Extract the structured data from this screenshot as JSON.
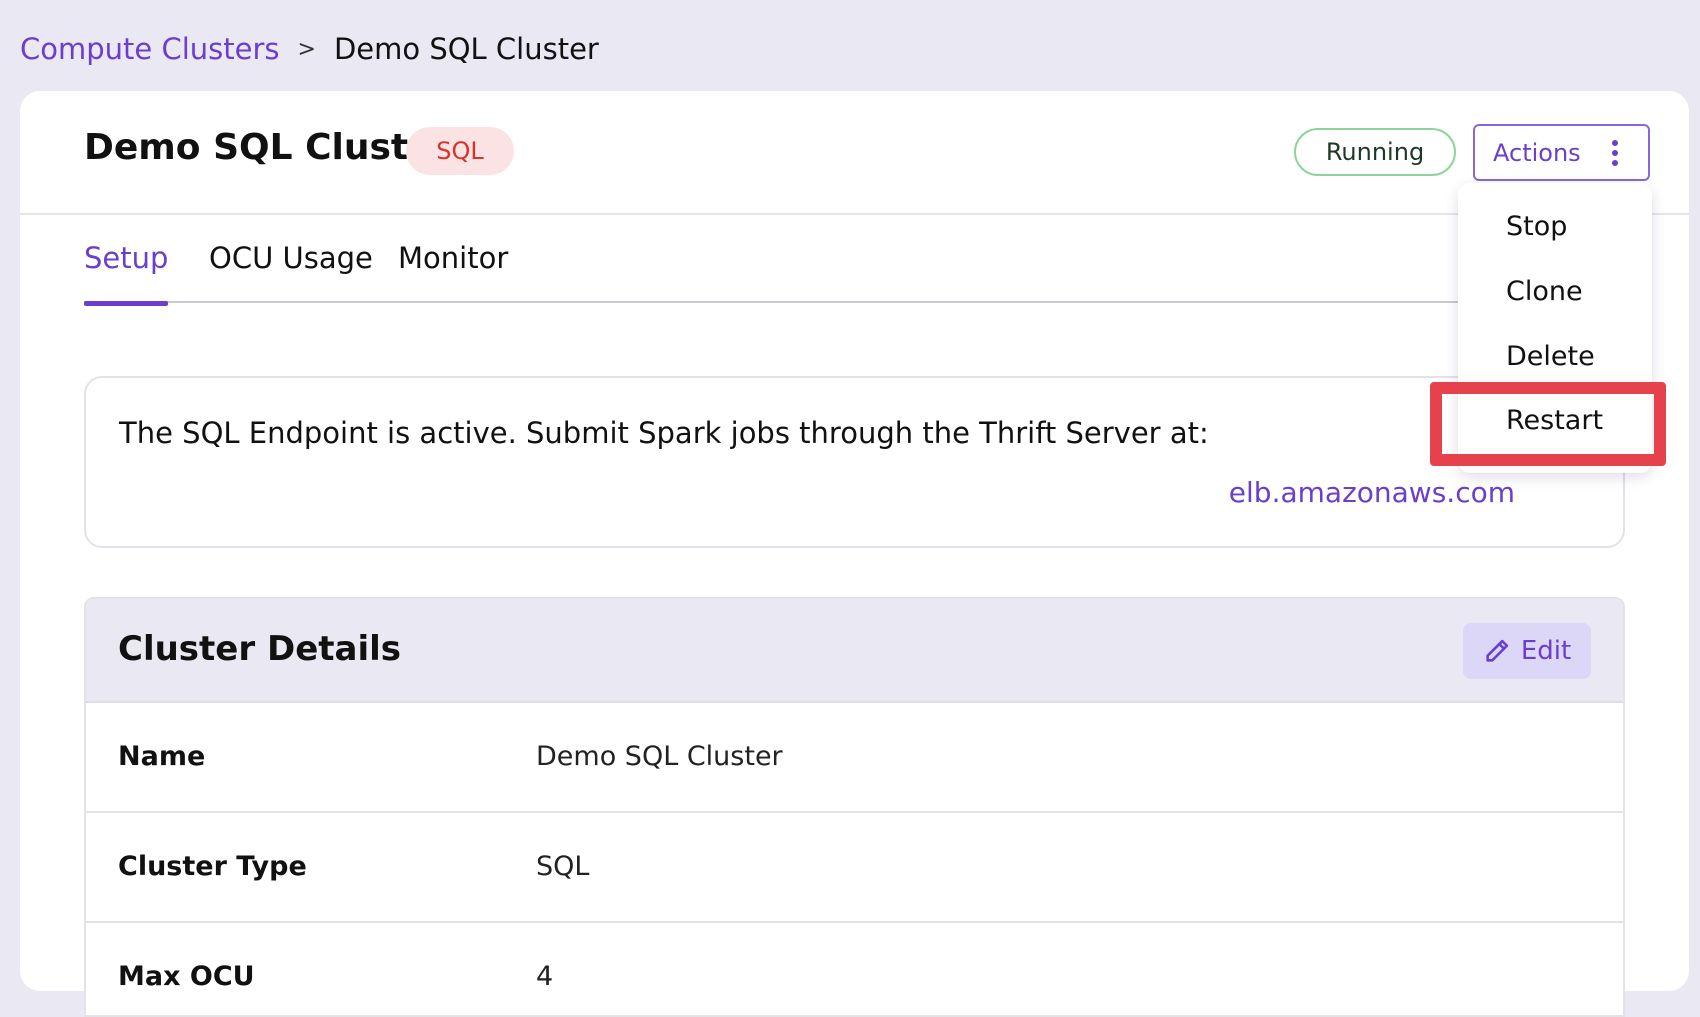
{
  "breadcrumb": {
    "parent": "Compute Clusters",
    "separator": ">",
    "current": "Demo SQL Cluster"
  },
  "header": {
    "title": "Demo SQL Cluster",
    "type_badge": "SQL",
    "status": "Running",
    "actions_label": "Actions"
  },
  "actions_menu": {
    "items": [
      "Stop",
      "Clone",
      "Delete",
      "Restart"
    ],
    "highlighted": "Restart"
  },
  "tabs": [
    {
      "label": "Setup",
      "active": true
    },
    {
      "label": "OCU Usage",
      "active": false
    },
    {
      "label": "Monitor",
      "active": false
    }
  ],
  "endpoint": {
    "message": "The SQL Endpoint is active. Submit Spark jobs through the Thrift Server at:",
    "url_visible": "elb.amazonaws.com"
  },
  "details": {
    "title": "Cluster Details",
    "edit_label": "Edit",
    "rows": [
      {
        "label": "Name",
        "value": "Demo SQL Cluster"
      },
      {
        "label": "Cluster Type",
        "value": "SQL"
      },
      {
        "label": "Max OCU",
        "value": "4"
      }
    ]
  },
  "colors": {
    "accent": "#6b3fce",
    "page_bg": "#e9e8f3",
    "status_border": "#8fd49a",
    "badge_bg": "#fbe3e3",
    "badge_text": "#d9322b",
    "highlight": "#e5424d"
  },
  "icons": {
    "actions": "kebab-vertical-icon",
    "edit": "pencil-icon"
  }
}
